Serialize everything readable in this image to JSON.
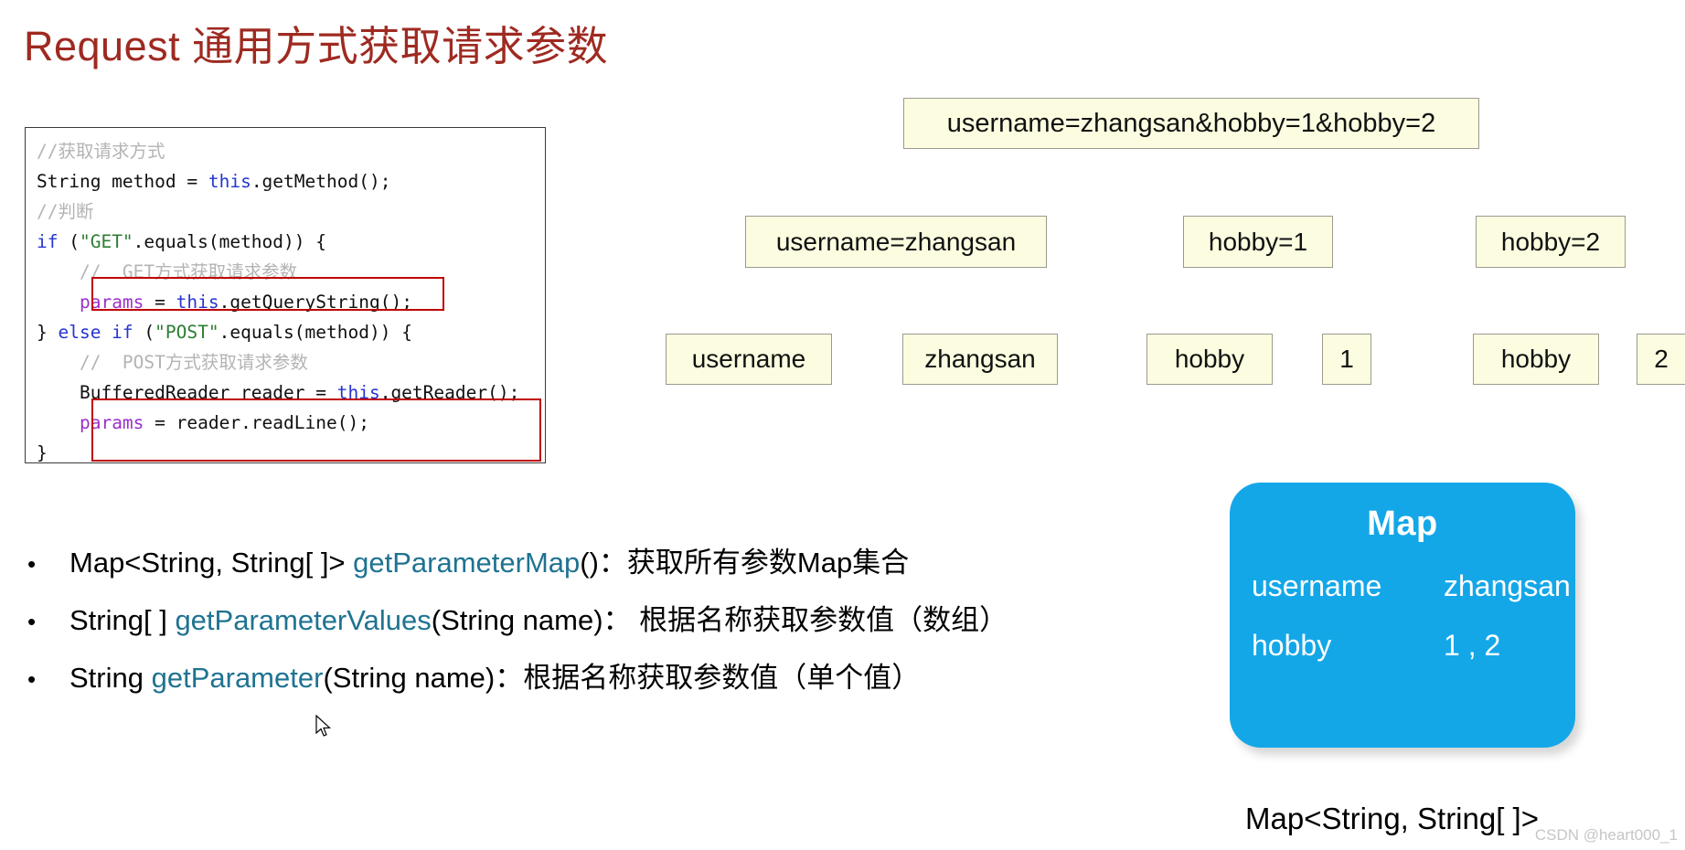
{
  "slide": {
    "title": "Request 通用方式获取请求参数"
  },
  "code_panel": {
    "lines": [
      [
        {
          "t": "comment",
          "s": "//获取请求方式"
        }
      ],
      [
        {
          "t": "plain",
          "s": "String method = "
        },
        {
          "t": "keyword",
          "s": "this"
        },
        {
          "t": "plain",
          "s": ".getMethod();"
        }
      ],
      [
        {
          "t": "comment",
          "s": "//判断"
        }
      ],
      [
        {
          "t": "keyword",
          "s": "if"
        },
        {
          "t": "plain",
          "s": " ("
        },
        {
          "t": "string",
          "s": "\"GET\""
        },
        {
          "t": "plain",
          "s": ".equals(method)) {"
        }
      ],
      [
        {
          "t": "comment",
          "s": "    //  GET方式获取请求参数"
        }
      ],
      [
        {
          "t": "plain",
          "s": "    "
        },
        {
          "t": "var",
          "s": "params"
        },
        {
          "t": "plain",
          "s": " = "
        },
        {
          "t": "keyword",
          "s": "this"
        },
        {
          "t": "plain",
          "s": ".getQueryString();"
        }
      ],
      [
        {
          "t": "plain",
          "s": "} "
        },
        {
          "t": "keyword",
          "s": "else if"
        },
        {
          "t": "plain",
          "s": " ("
        },
        {
          "t": "string",
          "s": "\"POST\""
        },
        {
          "t": "plain",
          "s": ".equals(method)) {"
        }
      ],
      [
        {
          "t": "comment",
          "s": "    //  POST方式获取请求参数"
        }
      ],
      [
        {
          "t": "plain",
          "s": "    BufferedReader reader = "
        },
        {
          "t": "keyword",
          "s": "this"
        },
        {
          "t": "plain",
          "s": ".getReader();"
        }
      ],
      [
        {
          "t": "plain",
          "s": "    "
        },
        {
          "t": "var",
          "s": "params"
        },
        {
          "t": "plain",
          "s": " = reader.readLine();"
        }
      ],
      [
        {
          "t": "plain",
          "s": "}"
        }
      ]
    ],
    "highlight_color": "#C00000",
    "highlights": [
      "params = this.getQueryString();",
      "BufferedReader reader = this.getReader(); / params = reader.readLine();"
    ]
  },
  "flow": {
    "box_fill": "#FCFCE0",
    "box_border": "#9c9a8e",
    "query_string": "username=zhangsan&hobby=1&hobby=2",
    "level2": [
      "username=zhangsan",
      "hobby=1",
      "hobby=2"
    ],
    "level3": [
      "username",
      "zhangsan",
      "hobby",
      "1",
      "hobby",
      "2"
    ]
  },
  "bullets": [
    {
      "marker": "•",
      "pre": "Map<String, String[ ]> ",
      "method": "getParameterMap",
      "post": "()：获取所有参数Map集合"
    },
    {
      "marker": "•",
      "pre": "String[ ] ",
      "method": "getParameterValues",
      "post": "(String name)： 根据名称获取参数值（数组）"
    },
    {
      "marker": "•",
      "pre": "String ",
      "method": "getParameter",
      "post": "(String name)：根据名称获取参数值（单个值）"
    }
  ],
  "map_card": {
    "accent_color": "#14A7E8",
    "title": "Map",
    "entries": [
      {
        "key": "username",
        "value": "zhangsan"
      },
      {
        "key": "hobby",
        "value": "1 , 2"
      }
    ],
    "caption": "Map<String, String[ ]>"
  },
  "watermark": {
    "text": "CSDN @heart000_1"
  }
}
